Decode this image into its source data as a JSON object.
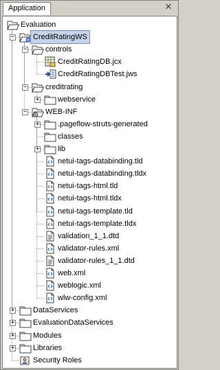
{
  "tab": {
    "label": "Application"
  },
  "close_glyph": "✕",
  "tree": [
    {
      "label": "Evaluation",
      "icon": "folder-open-icon",
      "level": 0,
      "expander": "none"
    },
    {
      "label": "CreditRatingWS",
      "icon": "web-project-icon",
      "level": 1,
      "expander": "minus",
      "selected": true
    },
    {
      "label": "controls",
      "icon": "folder-open-icon",
      "level": 2,
      "expander": "minus"
    },
    {
      "label": "CreditRatingDB.jcx",
      "icon": "database-control-icon",
      "level": 3,
      "expander": "none"
    },
    {
      "label": "CreditRatingDBTest.jws",
      "icon": "web-service-icon",
      "level": 3,
      "expander": "none"
    },
    {
      "label": "creditrating",
      "icon": "folder-open-icon",
      "level": 2,
      "expander": "minus"
    },
    {
      "label": "webservice",
      "icon": "folder-icon",
      "level": 3,
      "expander": "plus"
    },
    {
      "label": "WEB-INF",
      "icon": "gear-folder-icon",
      "level": 2,
      "expander": "minus"
    },
    {
      "label": ".pageflow-struts-generated",
      "icon": "folder-icon",
      "level": 3,
      "expander": "plus"
    },
    {
      "label": "classes",
      "icon": "folder-icon",
      "level": 3,
      "expander": "none"
    },
    {
      "label": "lib",
      "icon": "folder-icon",
      "level": 3,
      "expander": "plus"
    },
    {
      "label": "netui-tags-databinding.tld",
      "icon": "xml-file-icon",
      "level": 3,
      "expander": "none"
    },
    {
      "label": "netui-tags-databinding.tldx",
      "icon": "xml-file-icon",
      "level": 3,
      "expander": "none"
    },
    {
      "label": "netui-tags-html.tld",
      "icon": "xml-file-icon",
      "level": 3,
      "expander": "none"
    },
    {
      "label": "netui-tags-html.tldx",
      "icon": "xml-file-icon",
      "level": 3,
      "expander": "none"
    },
    {
      "label": "netui-tags-template.tld",
      "icon": "xml-file-icon",
      "level": 3,
      "expander": "none"
    },
    {
      "label": "netui-tags-template.tldx",
      "icon": "xml-file-icon",
      "level": 3,
      "expander": "none"
    },
    {
      "label": "validation_1_1.dtd",
      "icon": "text-file-icon",
      "level": 3,
      "expander": "none"
    },
    {
      "label": "validator-rules.xml",
      "icon": "xml-file-icon",
      "level": 3,
      "expander": "none"
    },
    {
      "label": "validator-rules_1_1.dtd",
      "icon": "text-file-icon",
      "level": 3,
      "expander": "none"
    },
    {
      "label": "web.xml",
      "icon": "xml-file-icon",
      "level": 3,
      "expander": "none"
    },
    {
      "label": "weblogic.xml",
      "icon": "xml-file-icon",
      "level": 3,
      "expander": "none"
    },
    {
      "label": "wlw-config.xml",
      "icon": "xml-file-icon",
      "level": 3,
      "expander": "none"
    },
    {
      "label": "DataServices",
      "icon": "folder-icon",
      "level": 1,
      "expander": "plus"
    },
    {
      "label": "EvaluationDataServices",
      "icon": "folder-icon",
      "level": 1,
      "expander": "plus"
    },
    {
      "label": "Modules",
      "icon": "folder-icon",
      "level": 1,
      "expander": "plus"
    },
    {
      "label": "Libraries",
      "icon": "folder-icon",
      "level": 1,
      "expander": "plus"
    },
    {
      "label": "Security Roles",
      "icon": "security-roles-icon",
      "level": 1,
      "expander": "none"
    }
  ]
}
